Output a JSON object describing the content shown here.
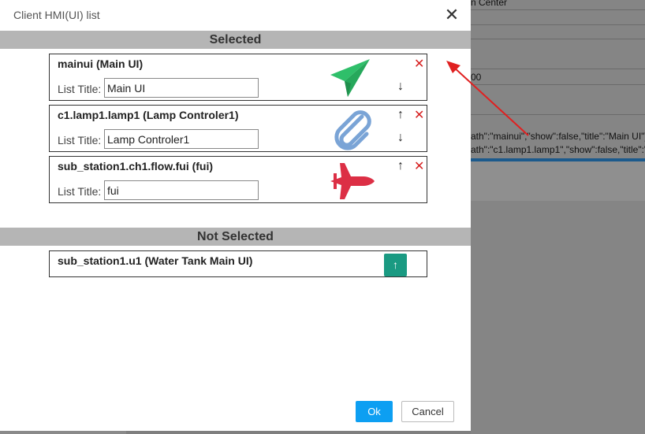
{
  "background": {
    "fragments": [
      "n Center",
      "00",
      "ath\":\"mainui\",\"show\":false,\"title\":\"Main UI\"}",
      "ath\":\"c1.lamp1.lamp1\",\"show\":false,\"title\":\""
    ]
  },
  "dialog": {
    "title": "Client HMI(UI) list",
    "close_glyph": "✕",
    "selected_header": "Selected",
    "not_selected_header": "Not Selected",
    "list_title_label": "List Title:",
    "selected_items": [
      {
        "name": "mainui (Main UI)",
        "title_value": "Main UI",
        "icon": "paper-plane-icon",
        "icon_color": "#2fbf6a"
      },
      {
        "name": "c1.lamp1.lamp1 (Lamp Controler1)",
        "title_value": "Lamp Controler1",
        "icon": "paperclip-icon",
        "icon_color": "#7aa4d6"
      },
      {
        "name": "sub_station1.ch1.flow.fui (fui)",
        "title_value": "fui",
        "icon": "fighter-jet-icon",
        "icon_color": "#dc2f45"
      }
    ],
    "not_selected_items": [
      {
        "name": "sub_station1.u1 (Water Tank Main UI)"
      }
    ],
    "glyphs": {
      "up": "↑",
      "down": "↓",
      "delete": "✕"
    },
    "buttons": {
      "ok": "Ok",
      "cancel": "Cancel"
    },
    "colors": {
      "ok": "#0d9ff2",
      "up_button": "#1a9a82",
      "delete": "#d62020",
      "annotation_arrow": "#e02020"
    }
  }
}
